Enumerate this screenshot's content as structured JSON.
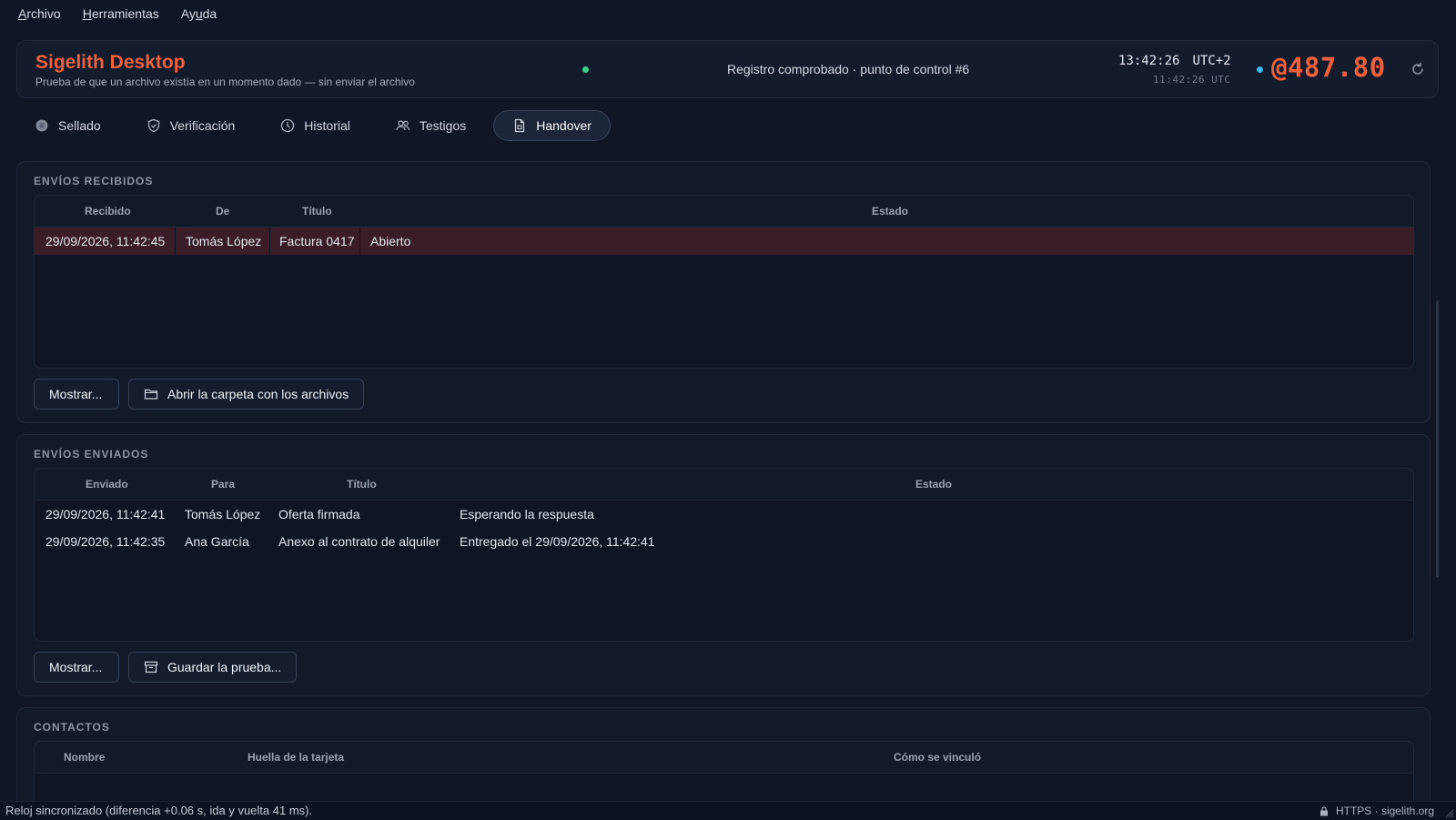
{
  "menu": {
    "items": [
      {
        "pre": "",
        "key": "A",
        "post": "rchivo"
      },
      {
        "pre": "",
        "key": "H",
        "post": "erramientas"
      },
      {
        "pre": "Ay",
        "key": "u",
        "post": "da"
      }
    ]
  },
  "header": {
    "app_title": "Sigelith Desktop",
    "subtitle": "Prueba de que un archivo existía en un momento dado — sin enviar el archivo",
    "registro": "Registro comprobado · punto de control #6",
    "time_local": "13:42:26",
    "tz": "UTC+2",
    "time_utc": "11:42:26 UTC",
    "balance": "@487.80"
  },
  "tabs": [
    {
      "label": "Sellado",
      "icon": "seal-icon"
    },
    {
      "label": "Verificación",
      "icon": "shield-check-icon"
    },
    {
      "label": "Historial",
      "icon": "clock-icon"
    },
    {
      "label": "Testigos",
      "icon": "people-icon"
    },
    {
      "label": "Handover",
      "icon": "document-icon",
      "active": true
    }
  ],
  "received": {
    "title": "ENVÍOS RECIBIDOS",
    "headers": {
      "recibido": "Recibido",
      "de": "De",
      "titulo": "Título",
      "estado": "Estado"
    },
    "rows": [
      {
        "fecha": "29/09/2026, 11:42:45",
        "de": "Tomás López",
        "titulo": "Factura 0417",
        "estado": "Abierto"
      }
    ],
    "btn_show": "Mostrar...",
    "btn_folder": "Abrir la carpeta con los archivos"
  },
  "sent": {
    "title": "ENVÍOS ENVIADOS",
    "headers": {
      "enviado": "Enviado",
      "para": "Para",
      "titulo": "Título",
      "estado": "Estado"
    },
    "rows": [
      {
        "fecha": "29/09/2026, 11:42:41",
        "para": "Tomás López",
        "titulo": "Oferta firmada",
        "estado": "Esperando la respuesta"
      },
      {
        "fecha": "29/09/2026, 11:42:35",
        "para": "Ana García",
        "titulo": "Anexo al contrato de alquiler",
        "estado": "Entregado el 29/09/2026, 11:42:41"
      }
    ],
    "btn_show": "Mostrar...",
    "btn_save": "Guardar la prueba..."
  },
  "contacts": {
    "title": "CONTACTOS",
    "headers": {
      "nombre": "Nombre",
      "huella": "Huella de la tarjeta",
      "como": "Cómo se vinculó"
    }
  },
  "statusbar": {
    "text": "Reloj sincronizado (diferencia +0.06 s, ida y vuelta 41 ms).",
    "conn": "HTTPS · sigelith.org"
  },
  "colors": {
    "accent": "#f0603c",
    "ok": "#3ecf8e",
    "info": "#3ab5f0",
    "selected_row": "#3a1d26"
  }
}
